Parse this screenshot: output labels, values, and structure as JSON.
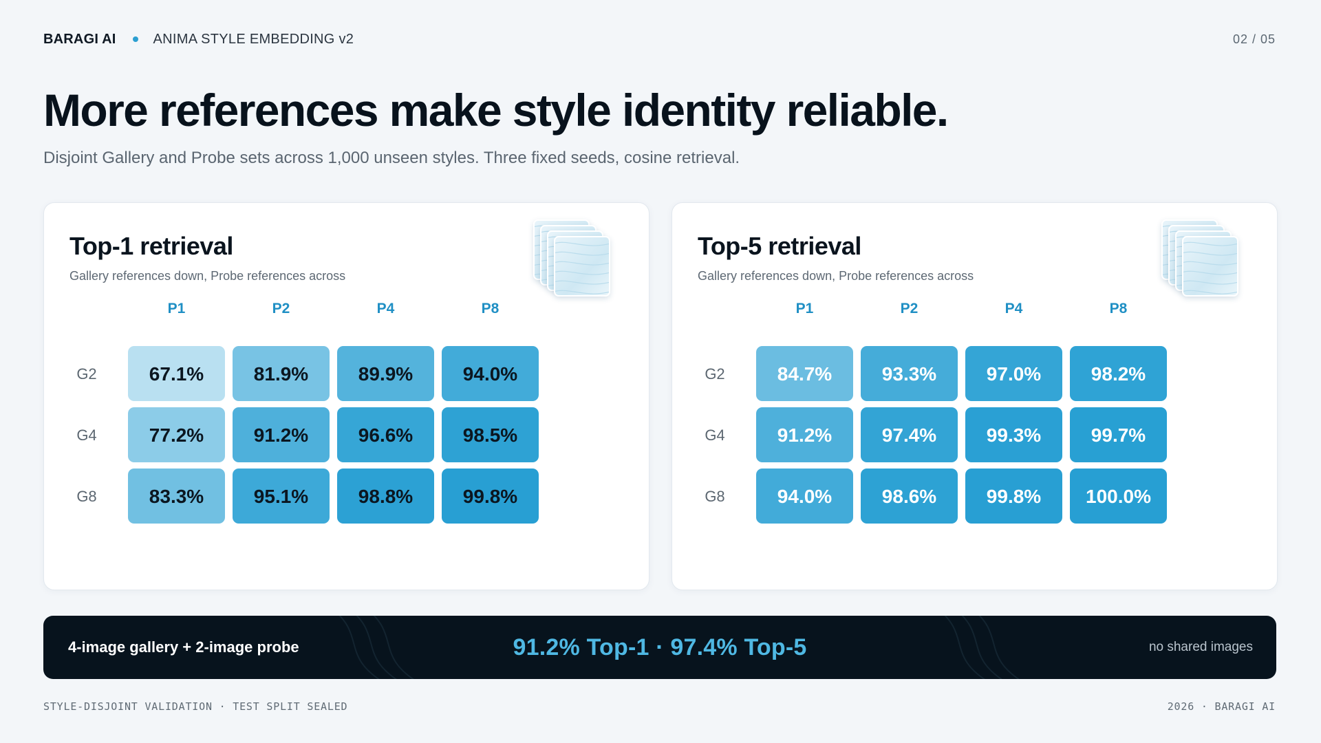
{
  "header": {
    "brand": "BARAGI AI",
    "project": "ANIMA STYLE EMBEDDING v2",
    "page": "02  /  05"
  },
  "headline": "More references make style identity reliable.",
  "subhead": "Disjoint Gallery and Probe sets across 1,000 unseen styles. Three fixed seeds, cosine retrieval.",
  "colors": {
    "accent": "#2b9fd1",
    "banner_bg": "#07131d",
    "banner_highlight": "#4fb8e3",
    "heat_low": "#d9eef8",
    "heat_high": "#279fd3",
    "axis_label": "#1f8fc4"
  },
  "icons": [
    "style-sample-stack-icon"
  ],
  "chart_data": [
    {
      "type": "heatmap",
      "title": "Top-1 retrieval",
      "subtitle": "Gallery references down, Probe references across",
      "x": [
        "P1",
        "P2",
        "P4",
        "P8"
      ],
      "y": [
        "G2",
        "G4",
        "G8"
      ],
      "values": [
        [
          67.1,
          81.9,
          89.9,
          94.0
        ],
        [
          77.2,
          91.2,
          96.6,
          98.5
        ],
        [
          83.3,
          95.1,
          98.8,
          99.8
        ]
      ],
      "labels": [
        [
          "67.1%",
          "81.9%",
          "89.9%",
          "94.0%"
        ],
        [
          "77.2%",
          "91.2%",
          "96.6%",
          "98.5%"
        ],
        [
          "83.3%",
          "95.1%",
          "98.8%",
          "99.8%"
        ]
      ],
      "unit": "%"
    },
    {
      "type": "heatmap",
      "title": "Top-5 retrieval",
      "subtitle": "Gallery references down, Probe references across",
      "x": [
        "P1",
        "P2",
        "P4",
        "P8"
      ],
      "y": [
        "G2",
        "G4",
        "G8"
      ],
      "values": [
        [
          84.7,
          93.3,
          97.0,
          98.2
        ],
        [
          91.2,
          97.4,
          99.3,
          99.7
        ],
        [
          94.0,
          98.6,
          99.8,
          100.0
        ]
      ],
      "labels": [
        [
          "84.7%",
          "93.3%",
          "97.0%",
          "98.2%"
        ],
        [
          "91.2%",
          "97.4%",
          "99.3%",
          "99.7%"
        ],
        [
          "94.0%",
          "98.6%",
          "99.8%",
          "100.0%"
        ]
      ],
      "unit": "%"
    }
  ],
  "banner": {
    "left": "4-image gallery + 2-image probe",
    "center": "91.2% Top-1 · 97.4% Top-5",
    "right": "no shared images"
  },
  "footer": {
    "left": "STYLE-DISJOINT VALIDATION  ·  TEST SPLIT SEALED",
    "right": "2026  ·  BARAGI AI"
  }
}
